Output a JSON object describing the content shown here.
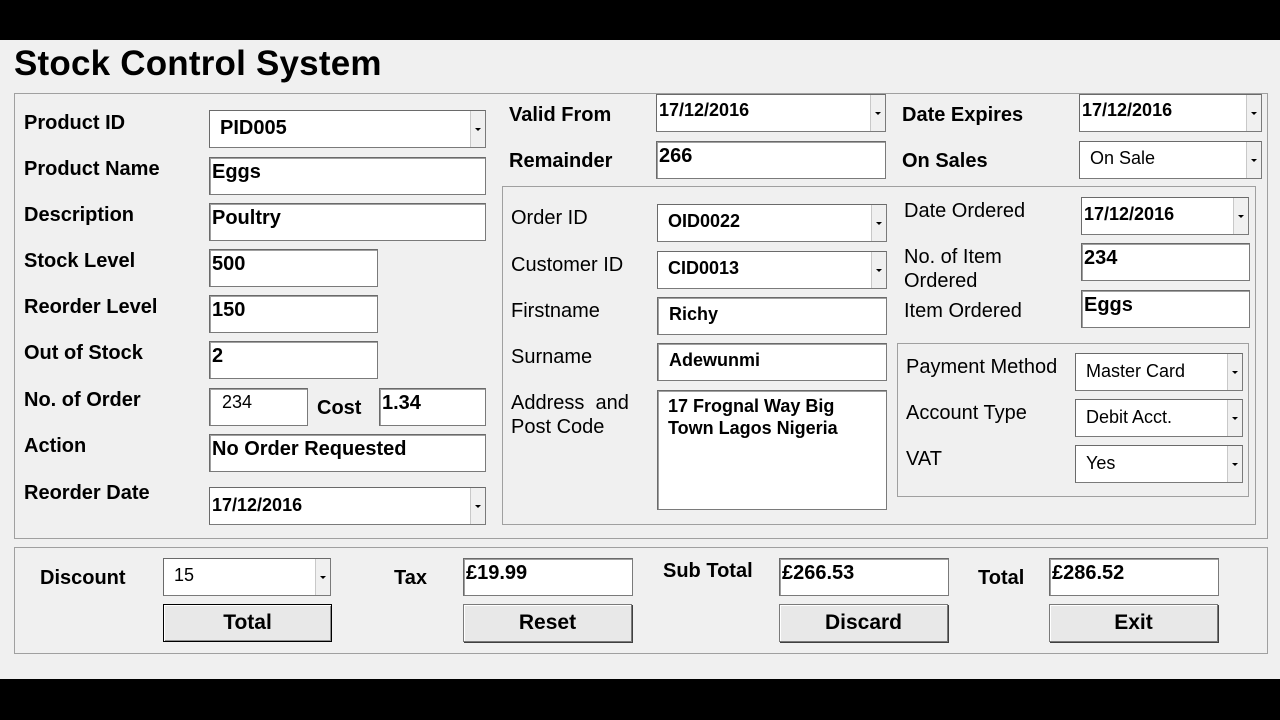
{
  "window": {
    "title": "Stock Control System"
  },
  "product": {
    "product_id_label": "Product ID",
    "product_id": "PID005",
    "product_name_label": "Product Name",
    "product_name": "Eggs",
    "description_label": "Description",
    "description": "Poultry",
    "stock_level_label": "Stock Level",
    "stock_level": "500",
    "reorder_level_label": "Reorder Level",
    "reorder_level": "150",
    "out_of_stock_label": "Out of Stock",
    "out_of_stock": "2",
    "no_of_order_label": "No. of Order",
    "no_of_order": "234",
    "cost_label": "Cost",
    "cost": "1.34",
    "action_label": "Action",
    "action": "No Order Requested",
    "reorder_date_label": "Reorder Date",
    "reorder_date": "17/12/2016"
  },
  "validity": {
    "valid_from_label": "Valid From",
    "valid_from": "17/12/2016",
    "date_expires_label": "Date Expires",
    "date_expires": "17/12/2016",
    "remainder_label": "Remainder",
    "remainder": "266",
    "on_sales_label": "On Sales",
    "on_sales": "On Sale"
  },
  "order": {
    "order_id_label": "Order ID",
    "order_id": "OID0022",
    "customer_id_label": "Customer ID",
    "customer_id": "CID0013",
    "firstname_label": "Firstname",
    "firstname": "Richy",
    "surname_label": "Surname",
    "surname": "Adewunmi",
    "address_label_line1": "Address  and",
    "address_label_line2": "Post Code",
    "address": "17 Frognal Way Big Town Lagos Nigeria",
    "date_ordered_label": "Date Ordered",
    "date_ordered": "17/12/2016",
    "items_ordered_count_label_line1": "No. of Item",
    "items_ordered_count_label_line2": "Ordered",
    "items_ordered_count": "234",
    "item_ordered_label": "Item Ordered",
    "item_ordered": "Eggs"
  },
  "payment": {
    "payment_method_label": "Payment Method",
    "payment_method": "Master Card",
    "account_type_label": "Account Type",
    "account_type": "Debit Acct.",
    "vat_label": "VAT",
    "vat": "Yes"
  },
  "totals": {
    "discount_label": "Discount",
    "discount": "15",
    "tax_label": "Tax",
    "tax": "£19.99",
    "subtotal_label": "Sub Total",
    "subtotal": "£266.53",
    "total_label": "Total",
    "total": "£286.52"
  },
  "buttons": {
    "total": "Total",
    "reset": "Reset",
    "discard": "Discard",
    "exit": "Exit"
  }
}
